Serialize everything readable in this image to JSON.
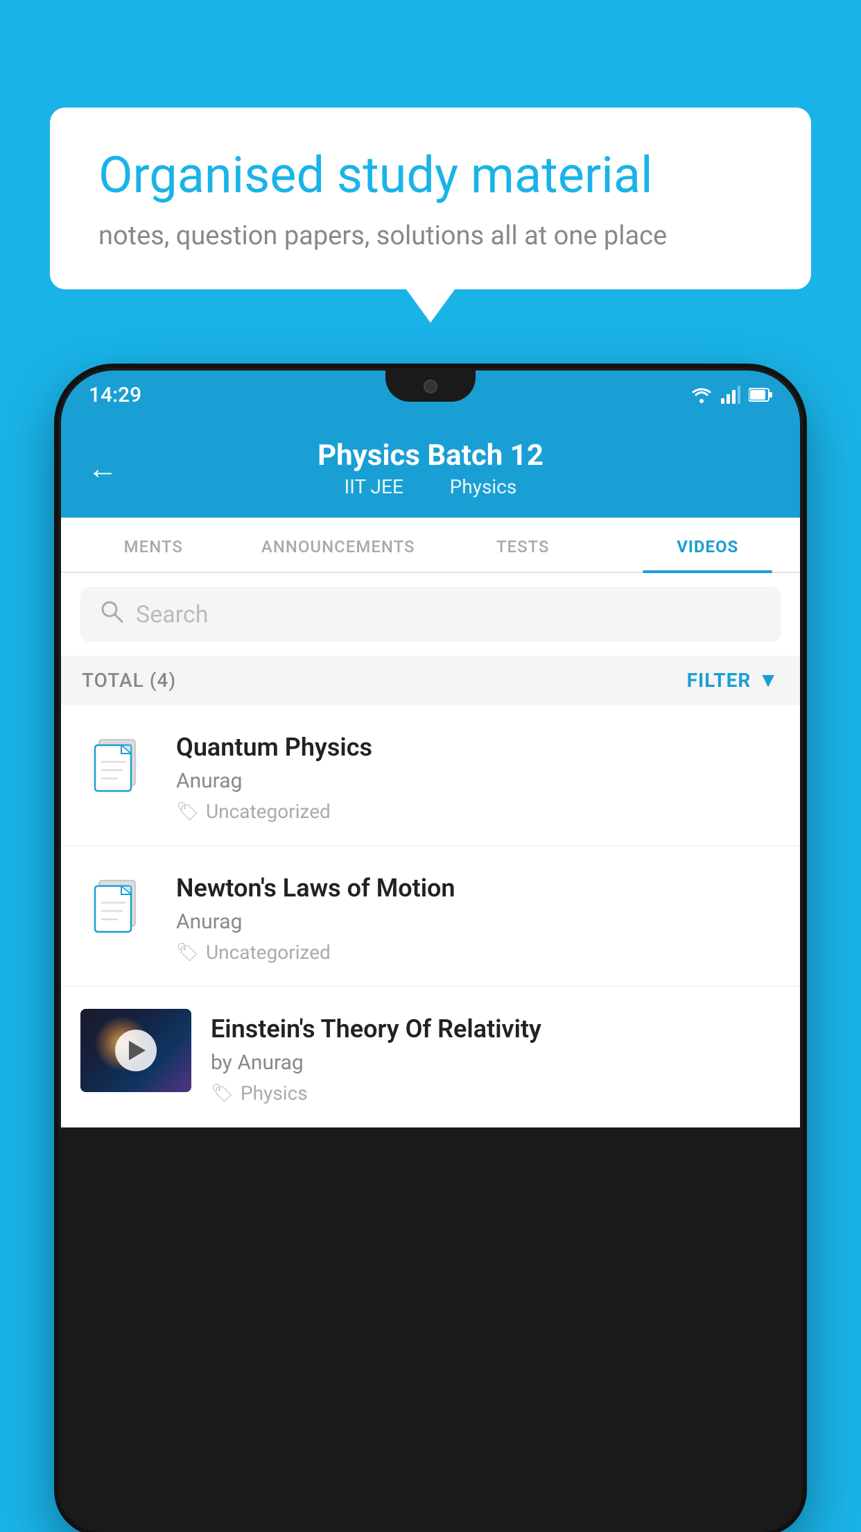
{
  "background_color": "#1ab3e8",
  "bubble": {
    "title": "Organised study material",
    "subtitle": "notes, question papers, solutions all at one place"
  },
  "status_bar": {
    "time": "14:29"
  },
  "header": {
    "back_label": "←",
    "title": "Physics Batch 12",
    "subtitle1": "IIT JEE",
    "subtitle2": "Physics"
  },
  "tabs": [
    {
      "label": "MENTS",
      "active": false
    },
    {
      "label": "ANNOUNCEMENTS",
      "active": false
    },
    {
      "label": "TESTS",
      "active": false
    },
    {
      "label": "VIDEOS",
      "active": true
    }
  ],
  "search": {
    "placeholder": "Search"
  },
  "filter": {
    "total_label": "TOTAL (4)",
    "filter_label": "FILTER"
  },
  "videos": [
    {
      "title": "Quantum Physics",
      "author": "Anurag",
      "tag": "Uncategorized",
      "has_thumb": false
    },
    {
      "title": "Newton's Laws of Motion",
      "author": "Anurag",
      "tag": "Uncategorized",
      "has_thumb": false
    },
    {
      "title": "Einstein's Theory Of Relativity",
      "author": "by Anurag",
      "tag": "Physics",
      "has_thumb": true
    }
  ]
}
